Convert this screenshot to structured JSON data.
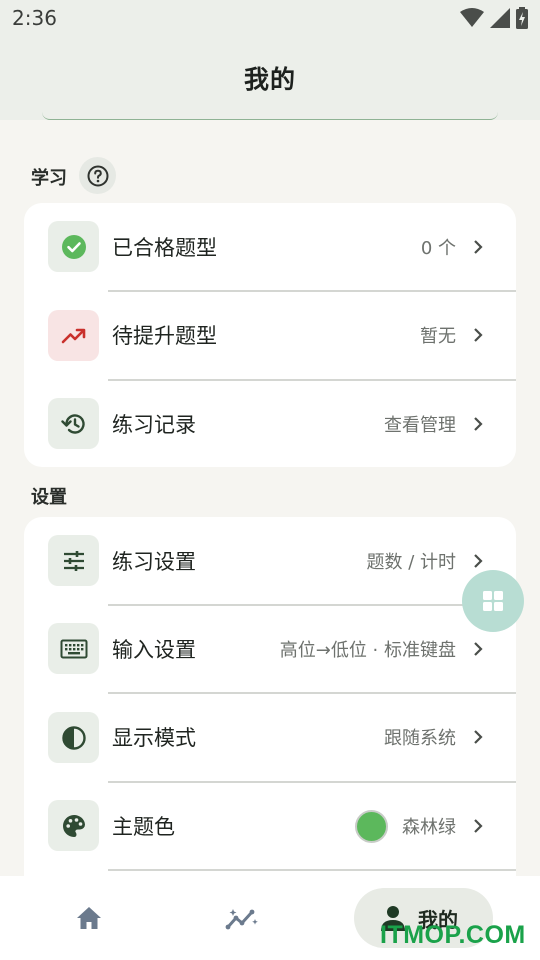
{
  "status_bar": {
    "time": "2:36"
  },
  "app_bar": {
    "title": "我的"
  },
  "study": {
    "section_title": "学习",
    "rows": [
      {
        "label": "已合格题型",
        "value": "0 个",
        "icon": "check-circle-icon"
      },
      {
        "label": "待提升题型",
        "value": "暂无",
        "icon": "trending-up-icon"
      },
      {
        "label": "练习记录",
        "value": "查看管理",
        "icon": "history-icon"
      }
    ]
  },
  "settings": {
    "section_title": "设置",
    "rows": [
      {
        "label": "练习设置",
        "value": "题数 / 计时",
        "icon": "sliders-icon"
      },
      {
        "label": "输入设置",
        "value": "高位→低位 · 标准键盘",
        "icon": "keyboard-icon"
      },
      {
        "label": "显示模式",
        "value": "跟随系统",
        "icon": "contrast-icon"
      },
      {
        "label": "主题色",
        "value": "森林绿",
        "icon": "palette-icon"
      }
    ]
  },
  "theme_color": "#5cb85c",
  "accent_color": "#3d6b44",
  "bottom_nav": {
    "items": [
      {
        "label": "",
        "icon": "home-icon"
      },
      {
        "label": "",
        "icon": "stats-icon"
      },
      {
        "label": "我的",
        "icon": "person-icon"
      }
    ]
  },
  "watermark": "ITMOP.COM"
}
